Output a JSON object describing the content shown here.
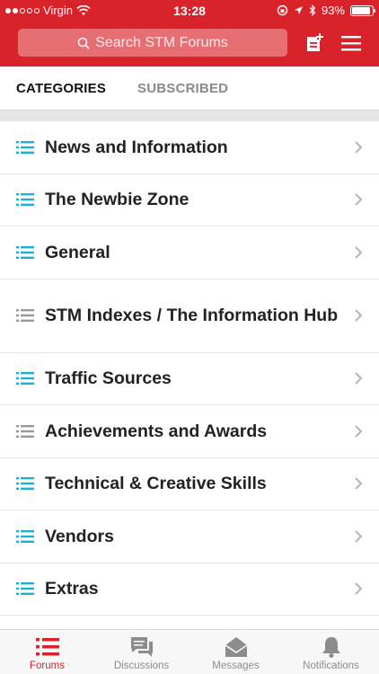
{
  "status_bar": {
    "carrier": "Virgin",
    "time": "13:28",
    "battery": "93%",
    "battery_level": 0.93
  },
  "header": {
    "search_placeholder": "Search STM Forums",
    "compose_icon": "new-post-icon",
    "menu_icon": "hamburger-menu-icon"
  },
  "tabs": [
    {
      "label": "CATEGORIES",
      "active": true
    },
    {
      "label": "SUBSCRIBED",
      "active": false
    }
  ],
  "categories": [
    {
      "label": "News and Information",
      "icon_color": "#1ab0d8"
    },
    {
      "label": "The Newbie Zone",
      "icon_color": "#1ab0d8"
    },
    {
      "label": "General",
      "icon_color": "#1ab0d8"
    },
    {
      "label": "STM Indexes / The Information Hub",
      "icon_color": "#999999"
    },
    {
      "label": "Traffic Sources",
      "icon_color": "#1ab0d8"
    },
    {
      "label": "Achievements and Awards",
      "icon_color": "#999999"
    },
    {
      "label": "Technical & Creative Skills",
      "icon_color": "#1ab0d8"
    },
    {
      "label": "Vendors",
      "icon_color": "#1ab0d8"
    },
    {
      "label": "Extras",
      "icon_color": "#1ab0d8"
    }
  ],
  "bottom_nav": [
    {
      "label": "Forums",
      "icon": "forums-list-icon",
      "active": true
    },
    {
      "label": "Discussions",
      "icon": "discussions-icon",
      "active": false
    },
    {
      "label": "Messages",
      "icon": "messages-icon",
      "active": false
    },
    {
      "label": "Notifications",
      "icon": "bell-icon",
      "active": false
    }
  ],
  "colors": {
    "brand_red": "#d9232a",
    "accent_blue": "#1ab0d8",
    "muted_gray": "#999999"
  }
}
